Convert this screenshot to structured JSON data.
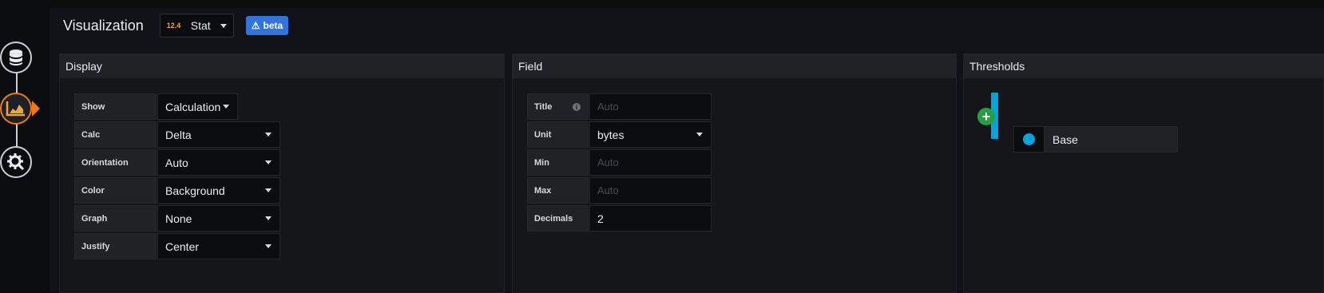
{
  "header": {
    "title": "Visualization",
    "picker": {
      "icon_text": "12.4",
      "label": "Stat"
    },
    "badge": "beta"
  },
  "nav": [
    {
      "name": "queries",
      "icon": "database-icon"
    },
    {
      "name": "visualization",
      "icon": "chart-icon",
      "active": true
    },
    {
      "name": "general",
      "icon": "cog-icon"
    }
  ],
  "display": {
    "title": "Display",
    "rows": [
      {
        "label": "Show",
        "value": "Calculation"
      },
      {
        "label": "Calc",
        "value": "Delta"
      },
      {
        "label": "Orientation",
        "value": "Auto"
      },
      {
        "label": "Color",
        "value": "Background"
      },
      {
        "label": "Graph",
        "value": "None"
      },
      {
        "label": "Justify",
        "value": "Center"
      }
    ]
  },
  "field": {
    "title": "Field",
    "rows": [
      {
        "label": "Title",
        "value": "",
        "placeholder": "Auto",
        "info": "i"
      },
      {
        "label": "Unit",
        "value": "bytes"
      },
      {
        "label": "Min",
        "value": "",
        "placeholder": "Auto"
      },
      {
        "label": "Max",
        "value": "",
        "placeholder": "Auto"
      },
      {
        "label": "Decimals",
        "value": "2"
      }
    ]
  },
  "thresholds": {
    "title": "Thresholds",
    "add_symbol": "+",
    "base_label": "Base",
    "base_color": "#00a5e0"
  },
  "colors": {
    "accent": "#eb7b18",
    "primary": "#3274d9",
    "success": "#299c46"
  }
}
